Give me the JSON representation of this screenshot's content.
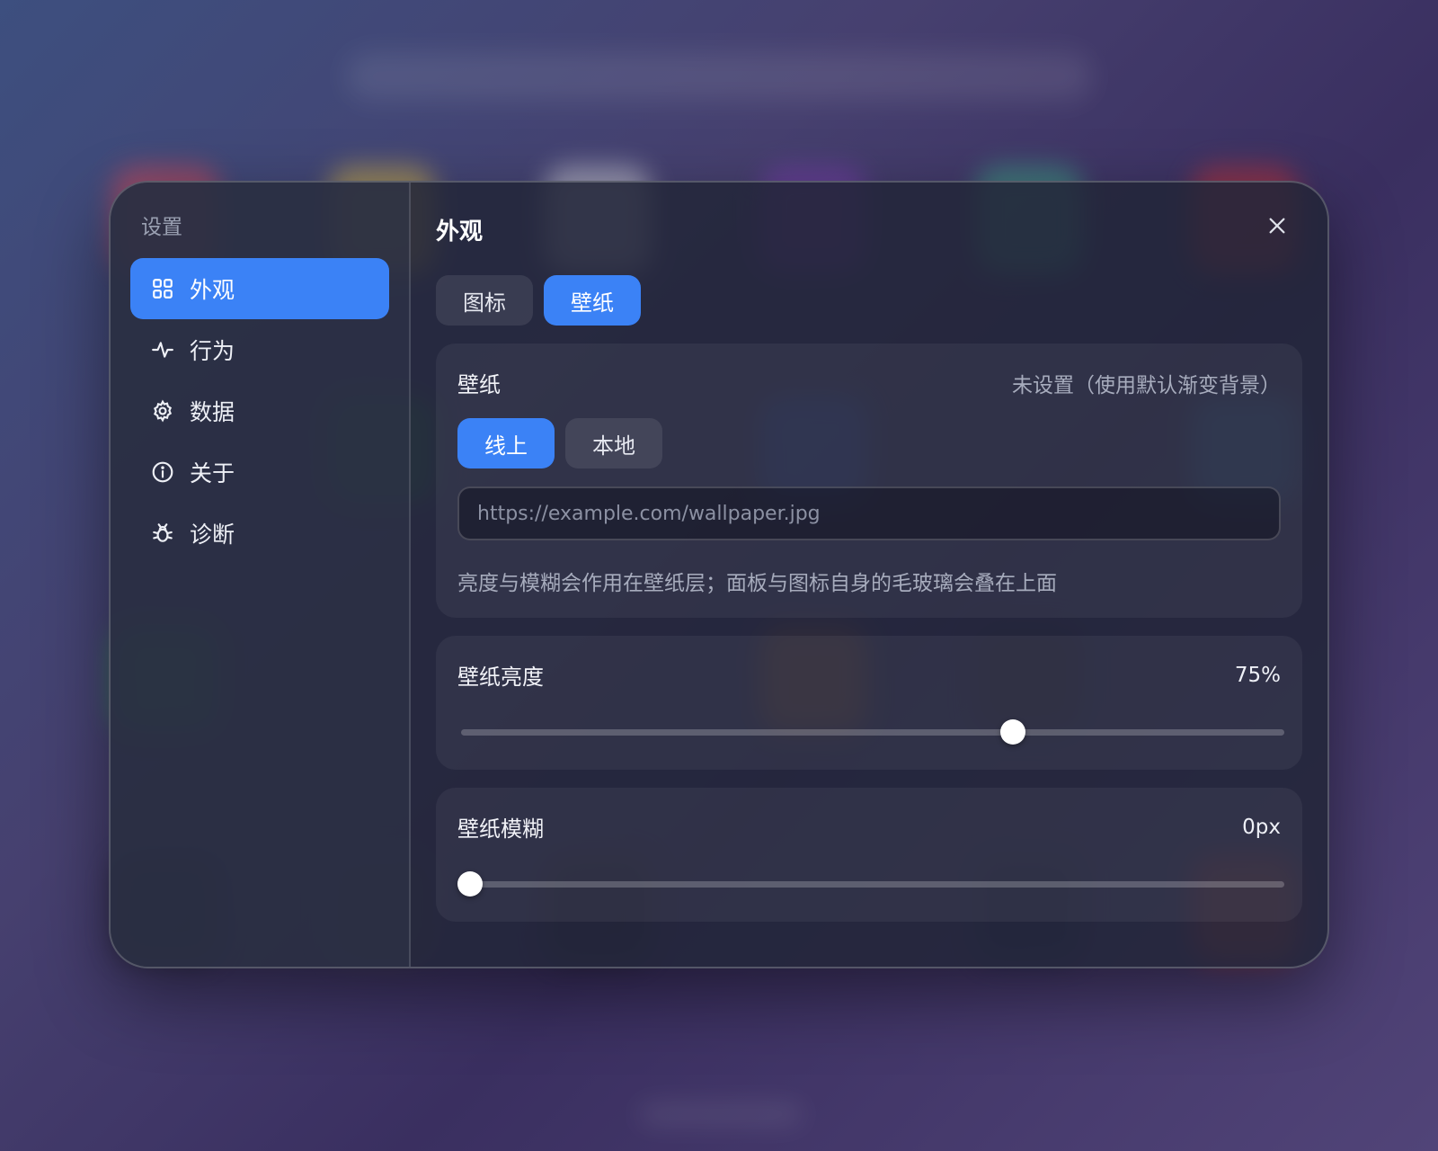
{
  "sidebar": {
    "title": "设置",
    "items": [
      {
        "label": "外观",
        "icon": "grid-icon",
        "active": true
      },
      {
        "label": "行为",
        "icon": "activity-icon",
        "active": false
      },
      {
        "label": "数据",
        "icon": "gear-icon",
        "active": false
      },
      {
        "label": "关于",
        "icon": "info-icon",
        "active": false
      },
      {
        "label": "诊断",
        "icon": "bug-icon",
        "active": false
      }
    ]
  },
  "main": {
    "title": "外观",
    "close_icon": "close-icon",
    "tabs": [
      {
        "label": "图标",
        "active": false
      },
      {
        "label": "壁纸",
        "active": true
      }
    ],
    "wallpaper_card": {
      "label": "壁纸",
      "status": "未设置（使用默认渐变背景）",
      "source_tabs": [
        {
          "label": "线上",
          "active": true
        },
        {
          "label": "本地",
          "active": false
        }
      ],
      "url_placeholder": "https://example.com/wallpaper.jpg",
      "url_value": "",
      "hint": "亮度与模糊会作用在壁纸层；面板与图标自身的毛玻璃会叠在上面"
    },
    "brightness_card": {
      "label": "壁纸亮度",
      "value_text": "75%",
      "value_fraction": 0.68
    },
    "blur_card": {
      "label": "壁纸模糊",
      "value_text": "0px",
      "value_fraction": 0
    }
  },
  "colors": {
    "accent": "#3b82f6",
    "dialog_bg": "#222538",
    "text_primary": "#f2f3f8",
    "text_muted": "#a7acbd"
  }
}
